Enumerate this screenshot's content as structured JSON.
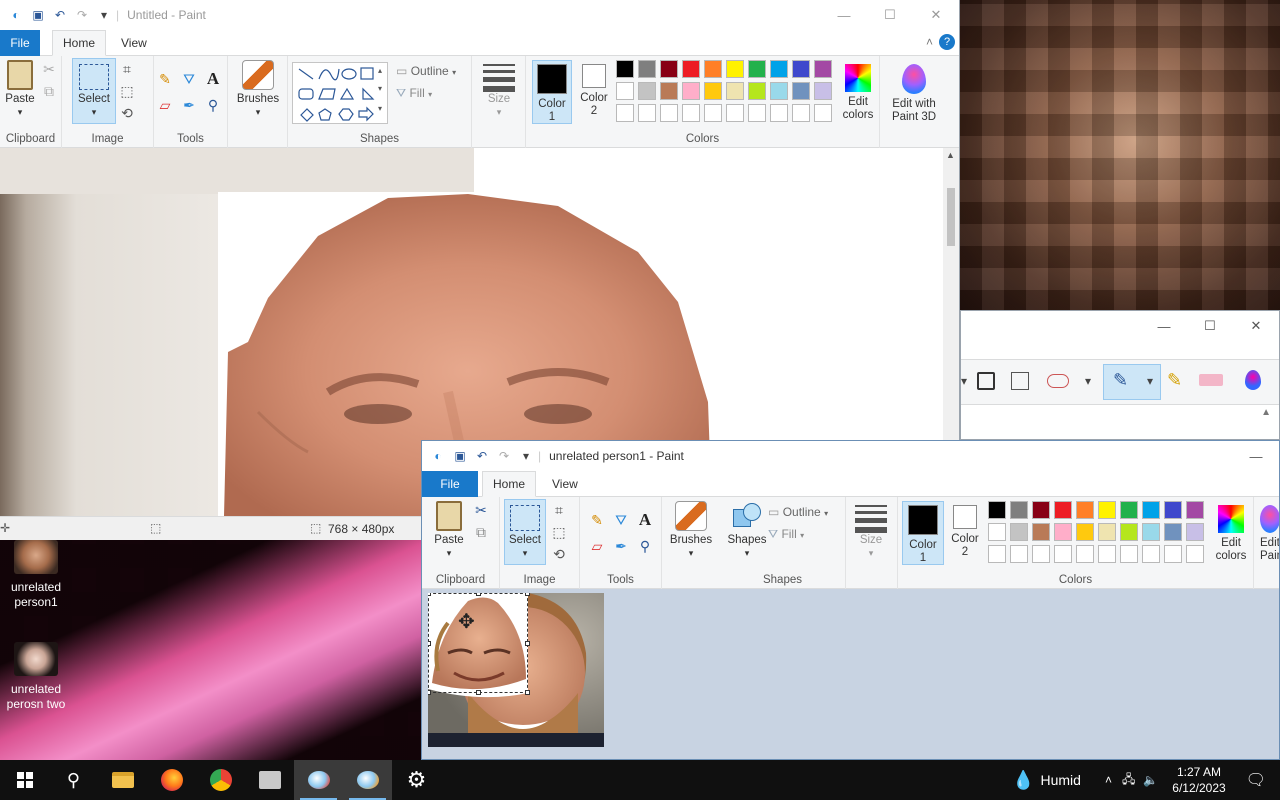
{
  "desktop": {
    "icons": [
      {
        "label_line1": "unrelated",
        "label_line2": "person1"
      },
      {
        "label_line1": "unrelated",
        "label_line2": "perosn two"
      }
    ]
  },
  "back_window": {
    "title": "Untitled - Paint",
    "tabs": {
      "file": "File",
      "home": "Home",
      "view": "View"
    },
    "groups": {
      "clipboard": "Clipboard",
      "image": "Image",
      "tools": "Tools",
      "shapes": "Shapes",
      "colors": "Colors"
    },
    "buttons": {
      "paste": "Paste",
      "select": "Select",
      "brushes": "Brushes",
      "outline": "Outline",
      "fill": "Fill",
      "size": "Size",
      "color1_line1": "Color",
      "color1_line2": "1",
      "color2_line1": "Color",
      "color2_line2": "2",
      "edit_colors_line1": "Edit",
      "edit_colors_line2": "colors",
      "edit3d_line1": "Edit with",
      "edit3d_line2": "Paint 3D"
    },
    "status": {
      "dimensions": "768 × 480px"
    }
  },
  "front_window": {
    "title": "unrelated person1 - Paint",
    "tabs": {
      "file": "File",
      "home": "Home",
      "view": "View"
    },
    "groups": {
      "clipboard": "Clipboard",
      "image": "Image",
      "tools": "Tools",
      "shapes": "Shapes",
      "colors": "Colors"
    },
    "buttons": {
      "paste": "Paste",
      "select": "Select",
      "brushes": "Brushes",
      "shapes": "Shapes",
      "outline": "Outline",
      "fill": "Fill",
      "size": "Size",
      "color1_line1": "Color",
      "color1_line2": "1",
      "color2_line1": "Color",
      "color2_line2": "2",
      "edit_colors_line1": "Edit",
      "edit_colors_line2": "colors",
      "edit3d_partial": "Edit",
      "edit3d_partial2": "Pain"
    }
  },
  "palette": {
    "row1": [
      "#000000",
      "#7f7f7f",
      "#880015",
      "#ed1c24",
      "#ff7f27",
      "#fff200",
      "#22b14c",
      "#00a2e8",
      "#3f48cc",
      "#a349a4"
    ],
    "row2": [
      "#ffffff",
      "#c3c3c3",
      "#b97a57",
      "#ffaec9",
      "#ffc90e",
      "#efe4b0",
      "#b5e61d",
      "#99d9ea",
      "#7092be",
      "#c8bfe7"
    ],
    "row3": [
      "#ffffff",
      "#ffffff",
      "#ffffff",
      "#ffffff",
      "#ffffff",
      "#ffffff",
      "#ffffff",
      "#ffffff",
      "#ffffff",
      "#ffffff"
    ]
  },
  "taskbar": {
    "weather": "Humid",
    "time": "1:27 AM",
    "date": "6/12/2023"
  }
}
